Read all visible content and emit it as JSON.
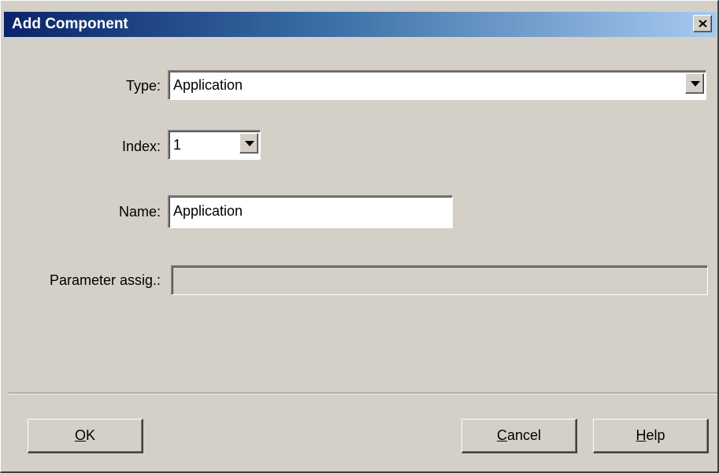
{
  "window": {
    "title": "Add Component",
    "close_icon": "close-x-icon"
  },
  "form": {
    "type": {
      "label": "Type:",
      "value": "Application"
    },
    "index": {
      "label": "Index:",
      "value": "1"
    },
    "name": {
      "label": "Name:",
      "value": "Application"
    },
    "parameter": {
      "label": "Parameter assig.:",
      "value": ""
    }
  },
  "buttons": {
    "ok": {
      "mnemonic": "O",
      "rest": "K"
    },
    "cancel": {
      "mnemonic": "C",
      "rest": "ancel"
    },
    "help": {
      "mnemonic": "H",
      "rest": "elp"
    }
  },
  "colors": {
    "title_start": "#0a246a",
    "title_end": "#a6caf0",
    "face": "#d4d0c8"
  }
}
